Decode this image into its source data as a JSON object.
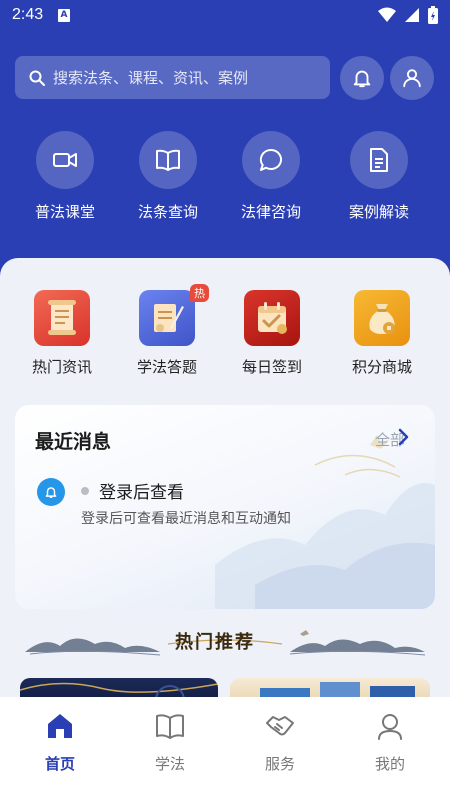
{
  "status": {
    "time": "2:43",
    "notification": "A"
  },
  "search": {
    "placeholder": "搜索法条、课程、资讯、案例"
  },
  "header_actions": {
    "bell": "bell-icon",
    "user": "user-icon"
  },
  "quick_actions": [
    {
      "label": "普法课堂",
      "icon": "video-icon"
    },
    {
      "label": "法条查询",
      "icon": "book-icon"
    },
    {
      "label": "法律咨询",
      "icon": "chat-icon"
    },
    {
      "label": "案例解读",
      "icon": "document-icon"
    }
  ],
  "services": [
    {
      "label": "热门资讯",
      "icon": "scroll-icon",
      "color": "#e84a3c"
    },
    {
      "label": "学法答题",
      "icon": "quiz-icon",
      "color": "#4a63d8",
      "badge": "热"
    },
    {
      "label": "每日签到",
      "icon": "calendar-check-icon",
      "color": "#c8241e"
    },
    {
      "label": "积分商城",
      "icon": "money-bag-icon",
      "color": "#f2a418"
    }
  ],
  "messages": {
    "title": "最近消息",
    "all_label": "全部",
    "item_title": "登录后查看",
    "item_subtitle": "登录后可查看最近消息和互动通知"
  },
  "hot_section": {
    "title": "热门推荐"
  },
  "tabbar": {
    "active_color": "#2a3fb3",
    "items": [
      {
        "label": "首页",
        "icon": "home-icon",
        "active": true
      },
      {
        "label": "学法",
        "icon": "book-icon",
        "active": false
      },
      {
        "label": "服务",
        "icon": "handshake-icon",
        "active": false
      },
      {
        "label": "我的",
        "icon": "user-icon",
        "active": false
      }
    ]
  },
  "colors": {
    "primary": "#2a3fb3",
    "background": "#eef1f8"
  }
}
